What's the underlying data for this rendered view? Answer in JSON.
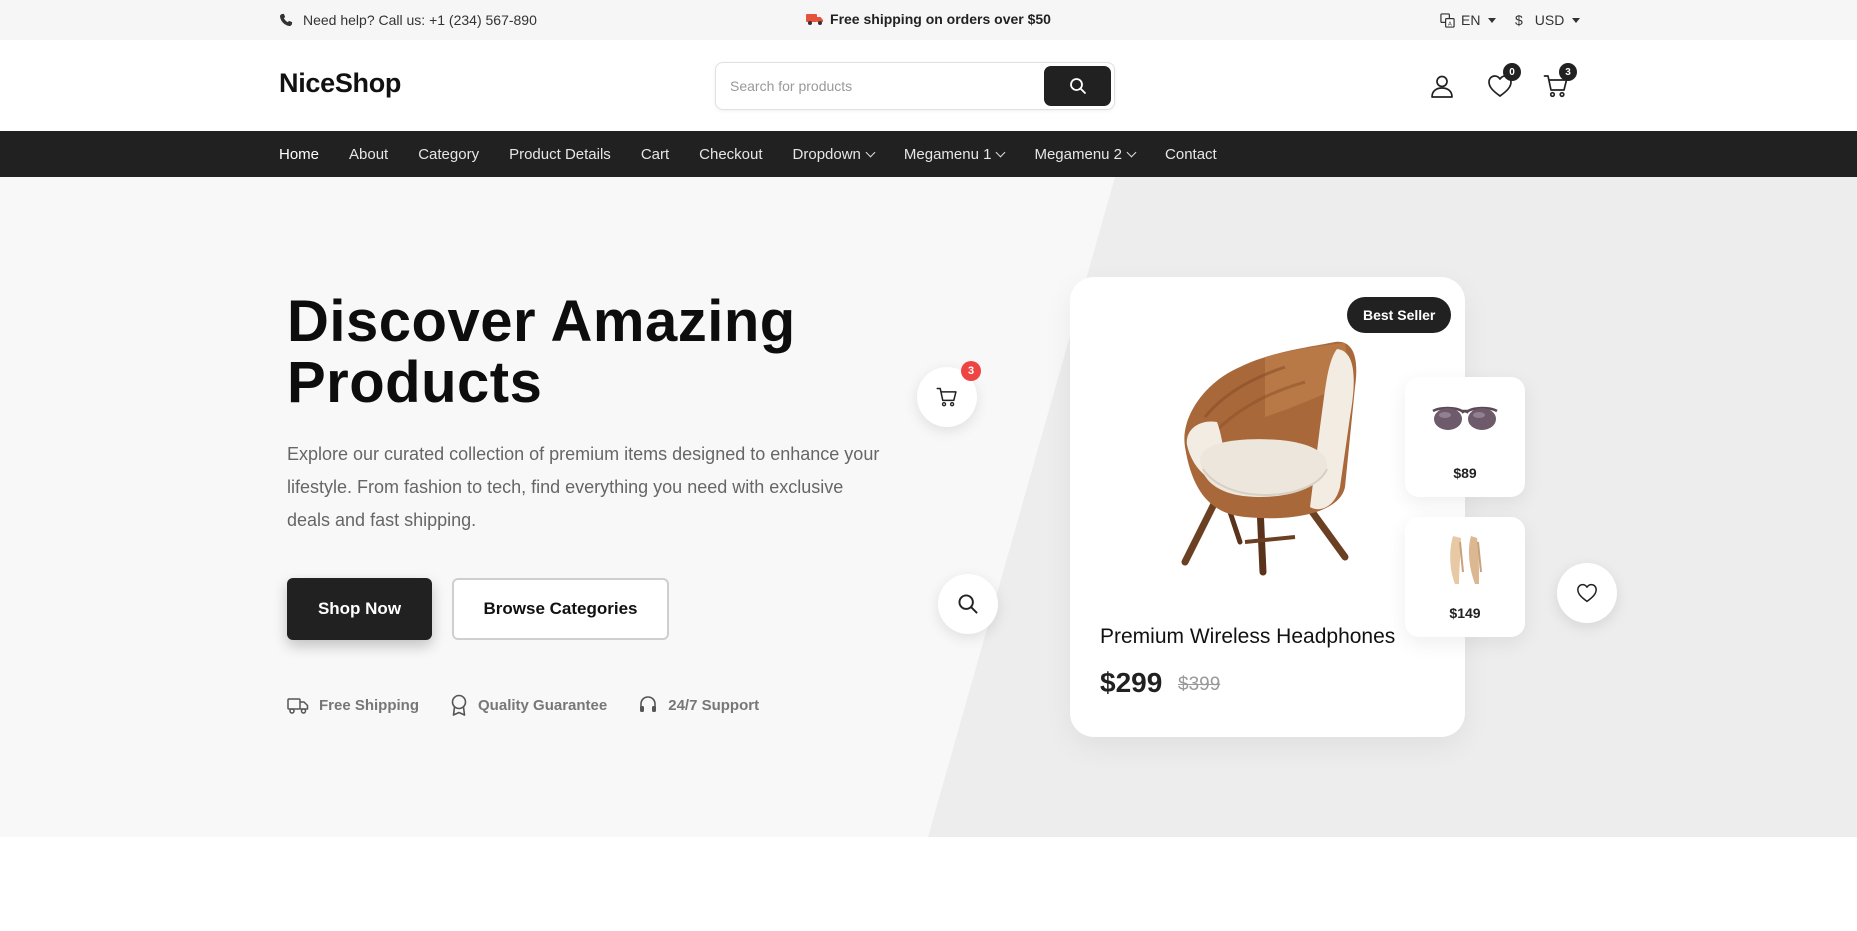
{
  "topbar": {
    "phone_text": "Need help? Call us: +1 (234) 567-890",
    "shipping_text": "Free shipping on orders over $50",
    "language": "EN",
    "currency_symbol": "$",
    "currency": "USD"
  },
  "header": {
    "logo": "NiceShop",
    "search_placeholder": "Search for products",
    "wishlist_count": "0",
    "cart_count": "3"
  },
  "nav": {
    "items": [
      {
        "label": "Home"
      },
      {
        "label": "About"
      },
      {
        "label": "Category"
      },
      {
        "label": "Product Details"
      },
      {
        "label": "Cart"
      },
      {
        "label": "Checkout"
      },
      {
        "label": "Dropdown"
      },
      {
        "label": "Megamenu 1"
      },
      {
        "label": "Megamenu 2"
      },
      {
        "label": "Contact"
      }
    ]
  },
  "hero": {
    "title_line1": "Discover Amazing",
    "title_line2": "Products",
    "description": "Explore our curated collection of premium items designed to enhance your lifestyle. From fashion to tech, find everything you need with exclusive deals and fast shipping.",
    "primary_button": "Shop Now",
    "secondary_button": "Browse Categories",
    "features": [
      {
        "label": "Free Shipping",
        "icon": "truck-icon"
      },
      {
        "label": "Quality Guarantee",
        "icon": "award-icon"
      },
      {
        "label": "24/7 Support",
        "icon": "headset-icon"
      }
    ],
    "floating_cart_count": "3"
  },
  "product_card": {
    "badge": "Best Seller",
    "title": "Premium Wireless Headphones",
    "price": "$299",
    "old_price": "$399"
  },
  "mini_cards": [
    {
      "price": "$89",
      "item": "sunglasses"
    },
    {
      "price": "$149",
      "item": "heels"
    }
  ],
  "colors": {
    "primary": "#212121",
    "badge_red": "#ef4444",
    "hero_bg": "#f8f8f8"
  }
}
